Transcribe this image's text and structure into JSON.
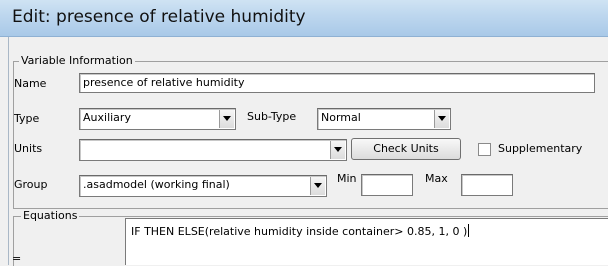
{
  "window": {
    "title": "Edit: presence of relative humidity"
  },
  "variable_info": {
    "legend": "Variable Information",
    "name_label": "Name",
    "name_value": "presence of relative humidity",
    "type_label": "Type",
    "type_value": "Auxiliary",
    "subtype_label": "Sub-Type",
    "subtype_value": "Normal",
    "units_label": "Units",
    "units_value": "",
    "check_units_label": "Check Units",
    "supplementary_label": "Supplementary",
    "supplementary_checked": false,
    "group_label": "Group",
    "group_value": ".asadmodel (working final)",
    "min_label": "Min",
    "min_value": "",
    "max_label": "Max",
    "max_value": ""
  },
  "equations": {
    "legend": "Equations",
    "equals_label": "=",
    "text": "IF THEN ELSE(relative humidity inside container> 0.85, 1, 0 )"
  },
  "icons": {
    "dropdown": "chevron-down-icon",
    "checkbox": "checkbox-icon"
  },
  "colors": {
    "titlebar": "#bcd6ee",
    "window_bg": "#f0f0f0",
    "field_bg": "#ffffff"
  }
}
